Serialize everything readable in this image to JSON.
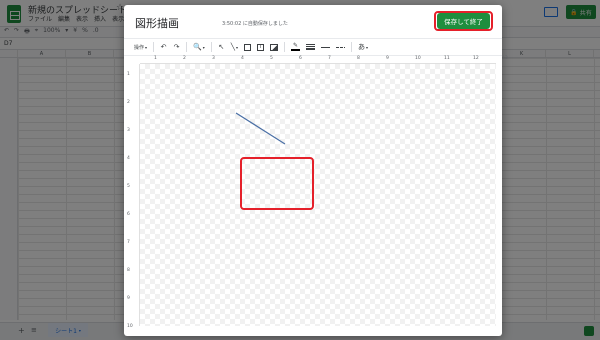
{
  "spreadsheet": {
    "doc_title": "新規のスプレッドシート",
    "star": "☆",
    "menu": [
      "ファイル",
      "編集",
      "表示",
      "挿入",
      "表示形式"
    ],
    "toolbar": [
      "↶",
      "↷",
      "🖶",
      "⌖",
      "100%",
      "▾",
      "¥",
      "%",
      ".0"
    ],
    "cell_ref": "D7",
    "columns": [
      "A",
      "B",
      "C",
      "D",
      "E",
      "F",
      "G",
      "H",
      "I",
      "J",
      "K",
      "L"
    ],
    "share_label": "共有",
    "add_sheet": "+",
    "all_sheets": "≡",
    "sheet_tab": "シート1"
  },
  "dialog": {
    "title": "図形描画",
    "autosave_status": "3:50:02 に自動保存しました",
    "save_close_label": "保存して終了",
    "toolbar": {
      "actions_label": "操作",
      "font_label": "あ"
    },
    "ruler_h": [
      "1",
      "2",
      "3",
      "4",
      "5",
      "6",
      "7",
      "8",
      "9",
      "10",
      "11",
      "12",
      "13"
    ],
    "ruler_v": [
      "1",
      "2",
      "3",
      "4",
      "5",
      "6",
      "7",
      "8",
      "9",
      "10"
    ],
    "line_color": "#4a6fa5"
  },
  "colors": {
    "accent_green": "#1e8e3e",
    "highlight_red": "#e5202a"
  }
}
